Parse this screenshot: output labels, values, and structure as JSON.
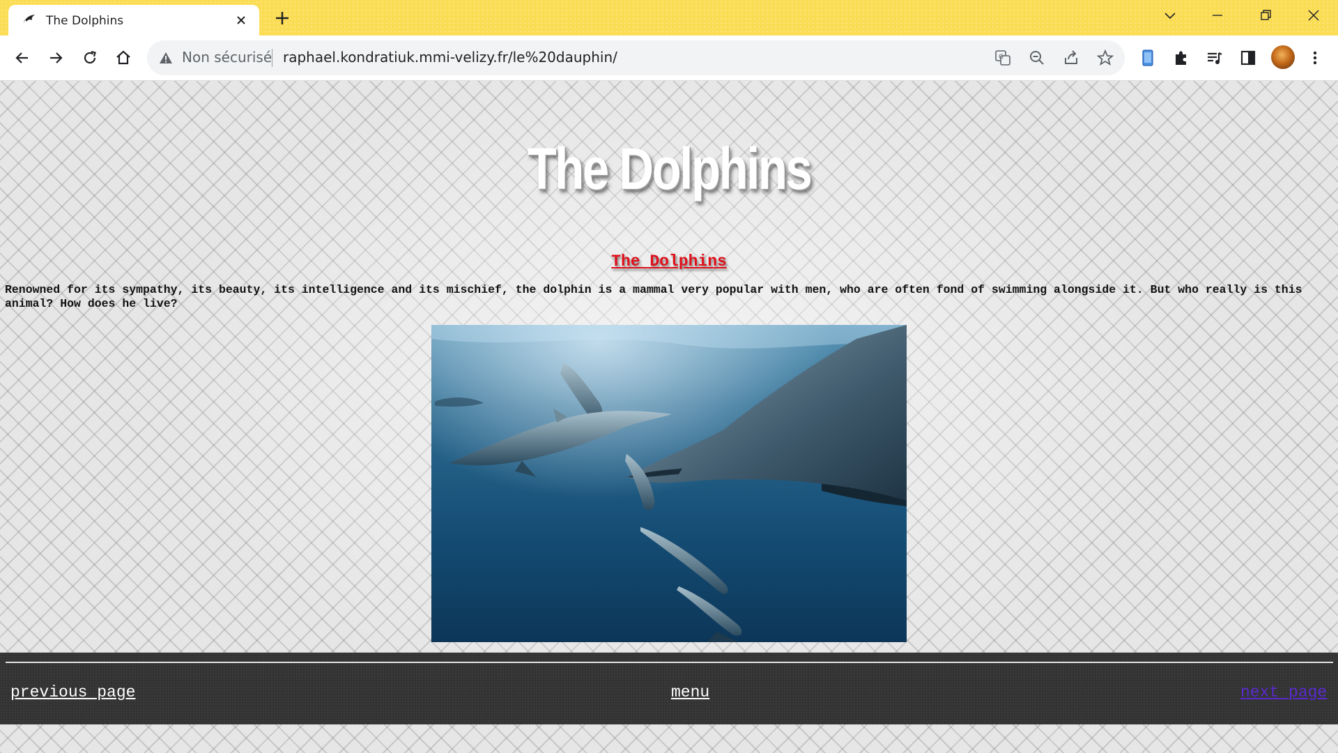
{
  "browser": {
    "tab_title": "The Dolphins",
    "security_label": "Non sécurisé",
    "url": "raphael.kondratiuk.mmi-velizy.fr/le%20dauphin/"
  },
  "page": {
    "logo_text": "The Dolphins",
    "heading": "The Dolphins",
    "intro_text": "Renowned for its sympathy, its beauty, its intelligence and its mischief, the dolphin is a mammal very popular with men, who are often fond of swimming alongside it. But who really is this animal? How does he live?",
    "footer": {
      "previous_label": "previous page",
      "menu_label": "menu",
      "next_label": "next page"
    }
  },
  "colors": {
    "titlebar": "#fbdd55",
    "heading_red": "#e0101a",
    "footer_bg": "#333333",
    "visited_link": "#5a2ad0"
  },
  "icons": [
    "dolphin-favicon-icon",
    "close-icon",
    "plus-icon",
    "chevron-down-icon",
    "minimize-icon",
    "restore-icon",
    "window-close-icon",
    "back-arrow-icon",
    "forward-arrow-icon",
    "reload-icon",
    "home-icon",
    "warning-icon",
    "translate-icon",
    "zoom-out-icon",
    "share-icon",
    "star-icon",
    "phone-extension-icon",
    "puzzle-icon",
    "media-queue-icon",
    "side-panel-icon",
    "kebab-menu-icon"
  ]
}
